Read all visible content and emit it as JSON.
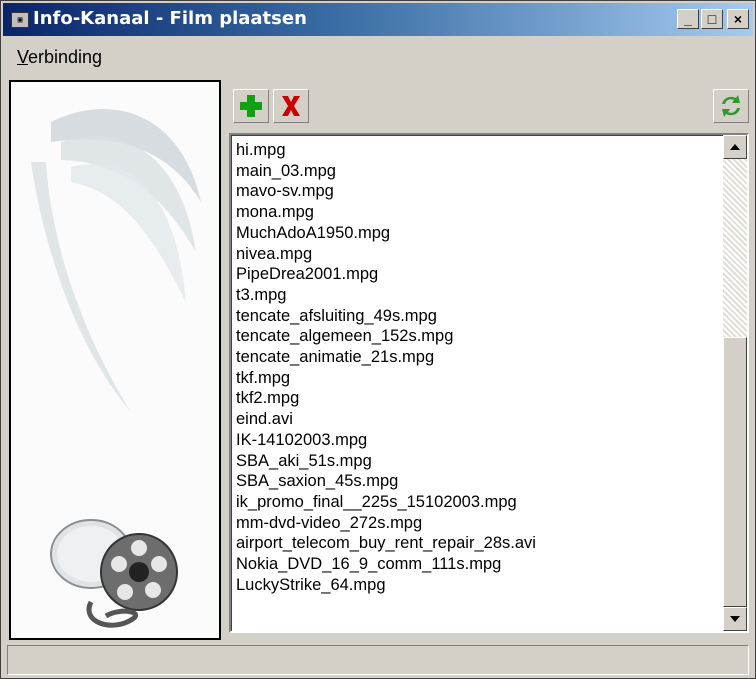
{
  "window": {
    "title": "Info-Kanaal - Film plaatsen",
    "icon": "app-icon",
    "controls": {
      "minimize": "_",
      "maximize": "□",
      "close": "×"
    }
  },
  "menu": {
    "items": [
      {
        "label": "Verbinding",
        "mnemonic": "V"
      }
    ]
  },
  "toolbar": {
    "add_icon": "plus-icon",
    "delete_icon": "delete-x-icon",
    "refresh_icon": "refresh-icon",
    "colors": {
      "add": "#14a014",
      "delete": "#cc0000",
      "refresh": "#2a9a2a"
    }
  },
  "files": [
    "hi.mpg",
    "main_03.mpg",
    "mavo-sv.mpg",
    "mona.mpg",
    "MuchAdoA1950.mpg",
    "nivea.mpg",
    "PipeDrea2001.mpg",
    "t3.mpg",
    "tencate_afsluiting_49s.mpg",
    "tencate_algemeen_152s.mpg",
    "tencate_animatie_21s.mpg",
    "tkf.mpg",
    "tkf2.mpg",
    "eind.avi",
    "IK-14102003.mpg",
    "SBA_aki_51s.mpg",
    "SBA_saxion_45s.mpg",
    "ik_promo_final__225s_15102003.mpg",
    "mm-dvd-video_272s.mpg",
    "airport_telecom_buy_rent_repair_28s.avi",
    "Nokia_DVD_16_9_comm_111s.mpg",
    "LuckyStrike_64.mpg"
  ],
  "scrollbar": {
    "up_icon": "scroll-up-arrow-icon",
    "down_icon": "scroll-down-arrow-icon"
  },
  "side_image": {
    "icon": "film-reel-icon"
  }
}
